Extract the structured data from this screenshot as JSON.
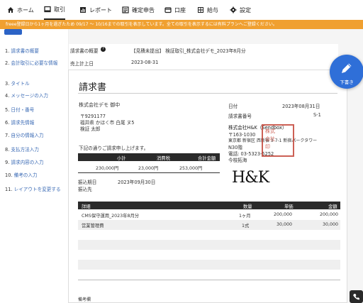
{
  "nav": {
    "items": [
      {
        "label": "ホーム",
        "icon": "home-icon"
      },
      {
        "label": "取引",
        "icon": "transaction-icon"
      },
      {
        "label": "レポート",
        "icon": "report-icon"
      },
      {
        "label": "確定申告",
        "icon": "tax-return-icon"
      },
      {
        "label": "口座",
        "icon": "wallet-icon"
      },
      {
        "label": "給与",
        "icon": "payroll-icon"
      },
      {
        "label": "設定",
        "icon": "gear-icon"
      }
    ],
    "active_index": 1
  },
  "banner": {
    "text": "freee登録日から1ヶ月を過ぎたため 09/17 〜 10/16までの取引を表示しています。全ての取引を表示するには有料プランへご登録ください。",
    "color": "#f0a030"
  },
  "sidebar": {
    "items": [
      {
        "num": "1.",
        "label": "請求書の概要"
      },
      {
        "num": "2.",
        "label": "会計取引に必要な情報"
      },
      {
        "num": "3.",
        "label": "タイトル"
      },
      {
        "num": "4.",
        "label": "メッセージの入力"
      },
      {
        "num": "5.",
        "label": "日付・番号"
      },
      {
        "num": "6.",
        "label": "請求先情報"
      },
      {
        "num": "7.",
        "label": "自分の情報入力"
      },
      {
        "num": "8.",
        "label": "支払方法入力"
      },
      {
        "num": "9.",
        "label": "請求内容の入力"
      },
      {
        "num": "10.",
        "label": "備考の入力"
      },
      {
        "num": "11.",
        "label": "レイアウトを変更する"
      }
    ]
  },
  "overview": {
    "label": "請求書の概要",
    "value": "【見積未提出】 検証取引_株式会社デモ_2023年8月分"
  },
  "sales_date": {
    "label": "売上計上日",
    "value": "2023-08-31"
  },
  "fab": {
    "label": "下書き",
    "icon": "pencil-icon",
    "color": "#2f6fd8"
  },
  "invoice": {
    "title": "請求書",
    "client_name": "株式会社デモ 御中",
    "client_zip": "〒9291177",
    "client_address": "福井県 かほく市 白尾 ヌ5",
    "client_contact": "検証 太郎",
    "date_label": "日付",
    "date_value": "2023年08月31日",
    "number_label": "請求書番号",
    "number_value": "S-1",
    "issuer_name": "株式会社H&K（Sendbox）",
    "issuer_zip": "〒163-1030",
    "issuer_address1": "東京都 新宿区 西新宿 3-7-1 新宿パークタワー",
    "issuer_address2": "N30階",
    "issuer_phone": "電話: 03-5323-5252",
    "issuer_contact": "今枝拓海",
    "stamp_text": "株式会社H&K",
    "logo_text": "H&K",
    "message": "下記の通りご請求申し上げます。",
    "summary_headers": [
      "小計",
      "消費税",
      "合計金額"
    ],
    "summary_values": [
      "230,000円",
      "23,000円",
      "253,000円"
    ],
    "due_label": "振込期日",
    "due_value": "2023年09月30日",
    "bank_label": "振込先",
    "items_headers": [
      "詳細",
      "数量",
      "単価",
      "金額"
    ],
    "items": [
      {
        "detail": "CMS保守運用_2023年8月分",
        "qty": "1ヶ月",
        "price": "200,000",
        "amount": "200,000"
      },
      {
        "detail": "営業管理費",
        "qty": "1式",
        "price": "30,000",
        "amount": "30,000"
      }
    ],
    "notes_label": "備考欄"
  }
}
